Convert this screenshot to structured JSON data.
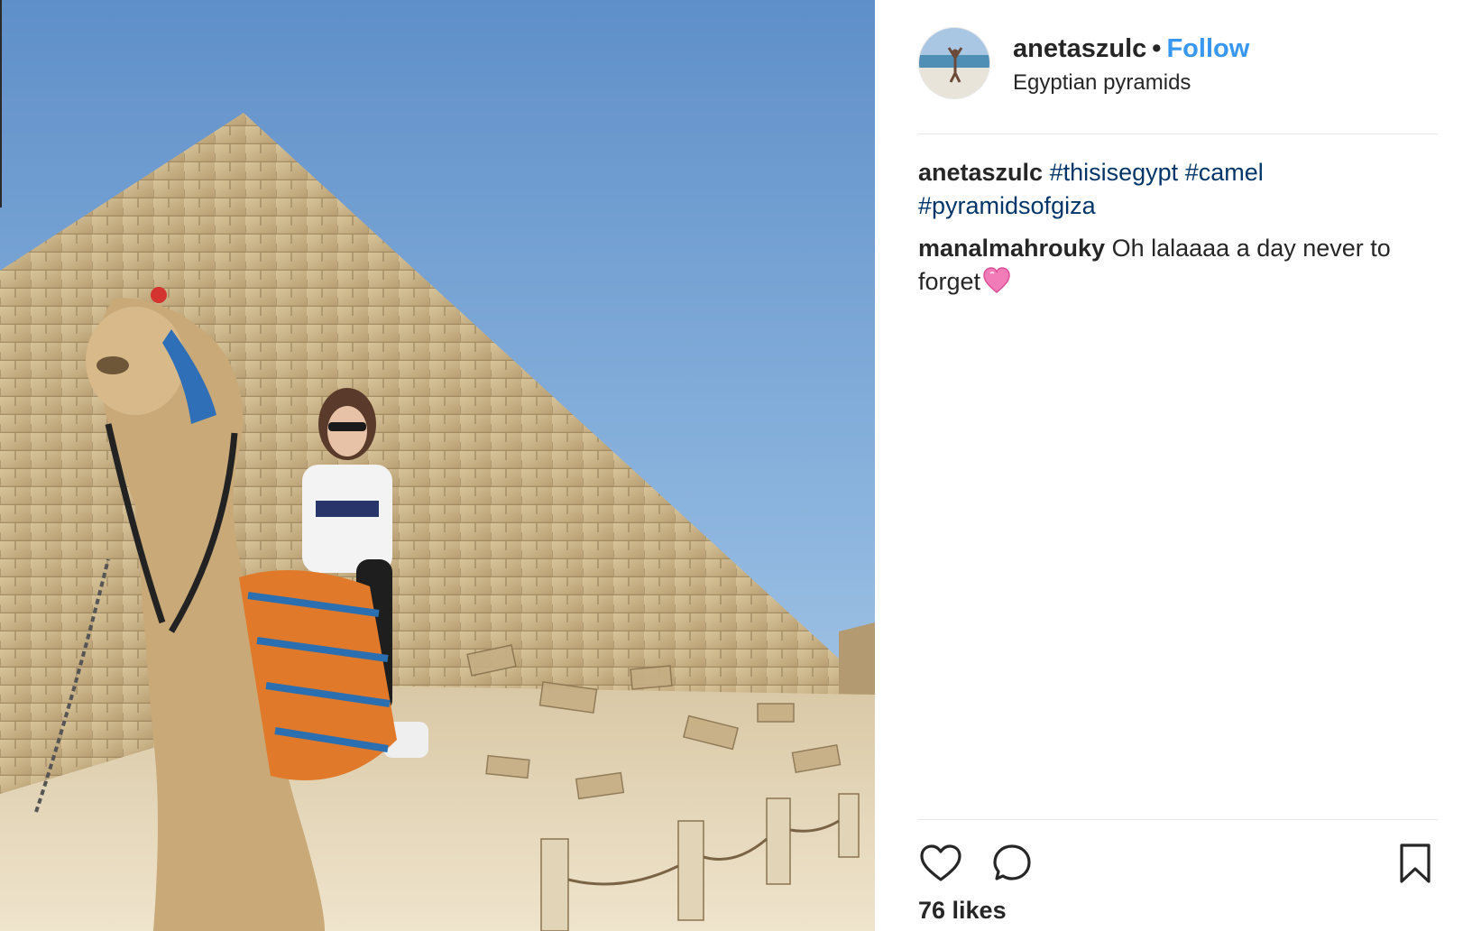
{
  "post": {
    "username": "anetaszulc",
    "separator": "•",
    "follow_label": "Follow",
    "location": "Egyptian pyramids",
    "likes": "76 likes"
  },
  "comments": [
    {
      "user": "anetaszulc",
      "text": "",
      "tags": [
        "#thisisegypt",
        "#camel",
        "#pyramidsofgiza"
      ]
    },
    {
      "user": "manalmahrouky",
      "text": "Oh lalaaaa a day never to forget",
      "emoji": "pink-heart-emoji"
    }
  ],
  "icons": {
    "like": "heart-outline-icon",
    "comment": "speech-bubble-icon",
    "save": "bookmark-icon"
  },
  "colors": {
    "follow": "#3897f0",
    "hashtag": "#003569",
    "text": "#262626",
    "divider": "#e6e6e6"
  }
}
